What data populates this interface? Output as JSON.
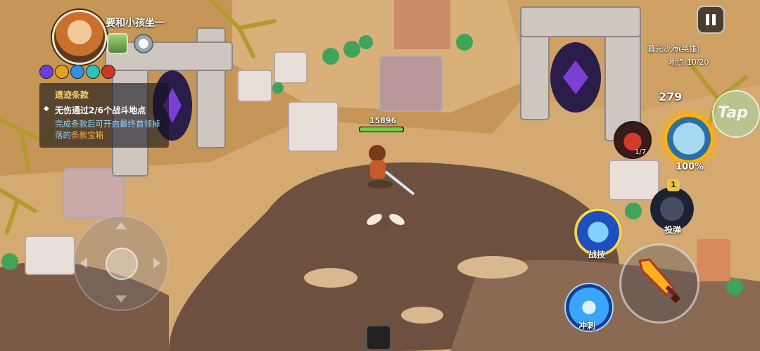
{
  "player": {
    "name": "要和小孩坐一"
  },
  "quest": {
    "title": "遗迹条款",
    "task": "无伤通过2/6个战斗地点",
    "desc_part1": "完成条款后可开启最终首领掉落的",
    "desc_highlight": "条款宝箱"
  },
  "zone": {
    "name": "暮光沙海(英雄)",
    "progress": "地点:10/20"
  },
  "character": {
    "hp": "15896",
    "hp_fraction": 1.0
  },
  "currency": {
    "count": "279"
  },
  "skills": {
    "potion_count": "1/7",
    "pet_charge": "100%",
    "tap_label": "Tap",
    "bomb_badge": "1",
    "bomb_label": "投弹",
    "combat_label": "战技",
    "dash_label": "冲刺"
  },
  "colors": {
    "quest_title": "#ffd36b",
    "quest_desc": "#8fd3ff",
    "quest_highlight": "#ffb347",
    "hp_fill": "#6bd24c"
  },
  "icons": [
    "avatar",
    "chest-icon",
    "badge-icon",
    "pause-icon",
    "potion-icon",
    "pet-icon",
    "bomb-icon",
    "combat-skill-icon",
    "sword-icon",
    "dash-icon",
    "joystick"
  ]
}
